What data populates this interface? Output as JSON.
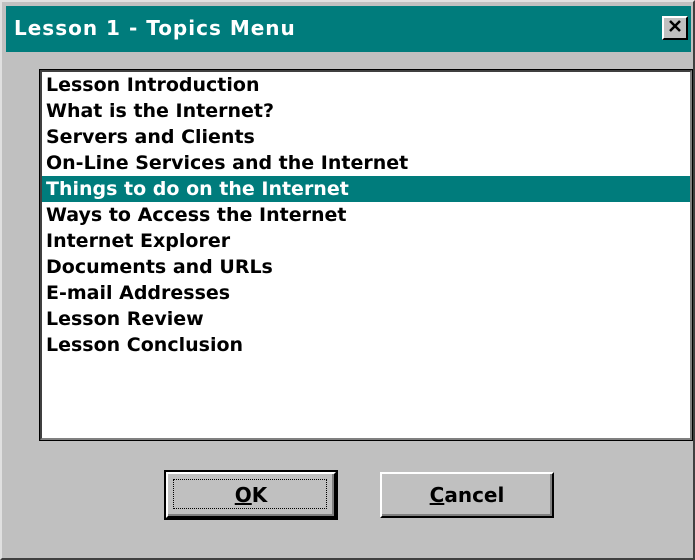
{
  "window": {
    "title": "Lesson 1 - Topics Menu",
    "accent_color": "#007c7c",
    "close_icon": "close-icon"
  },
  "topics": {
    "items": [
      {
        "label": "Lesson Introduction",
        "selected": false
      },
      {
        "label": "What is the Internet?",
        "selected": false
      },
      {
        "label": "Servers and Clients",
        "selected": false
      },
      {
        "label": "On-Line Services and the Internet",
        "selected": false
      },
      {
        "label": "Things to do on the Internet",
        "selected": true
      },
      {
        "label": "Ways to Access the Internet",
        "selected": false
      },
      {
        "label": "Internet Explorer",
        "selected": false
      },
      {
        "label": "Documents and URLs",
        "selected": false
      },
      {
        "label": "E-mail Addresses",
        "selected": false
      },
      {
        "label": "Lesson Review",
        "selected": false
      },
      {
        "label": "Lesson Conclusion",
        "selected": false
      }
    ]
  },
  "buttons": {
    "ok_mnemonic": "O",
    "ok_rest": "K",
    "cancel_mnemonic": "C",
    "cancel_rest": "ancel"
  }
}
